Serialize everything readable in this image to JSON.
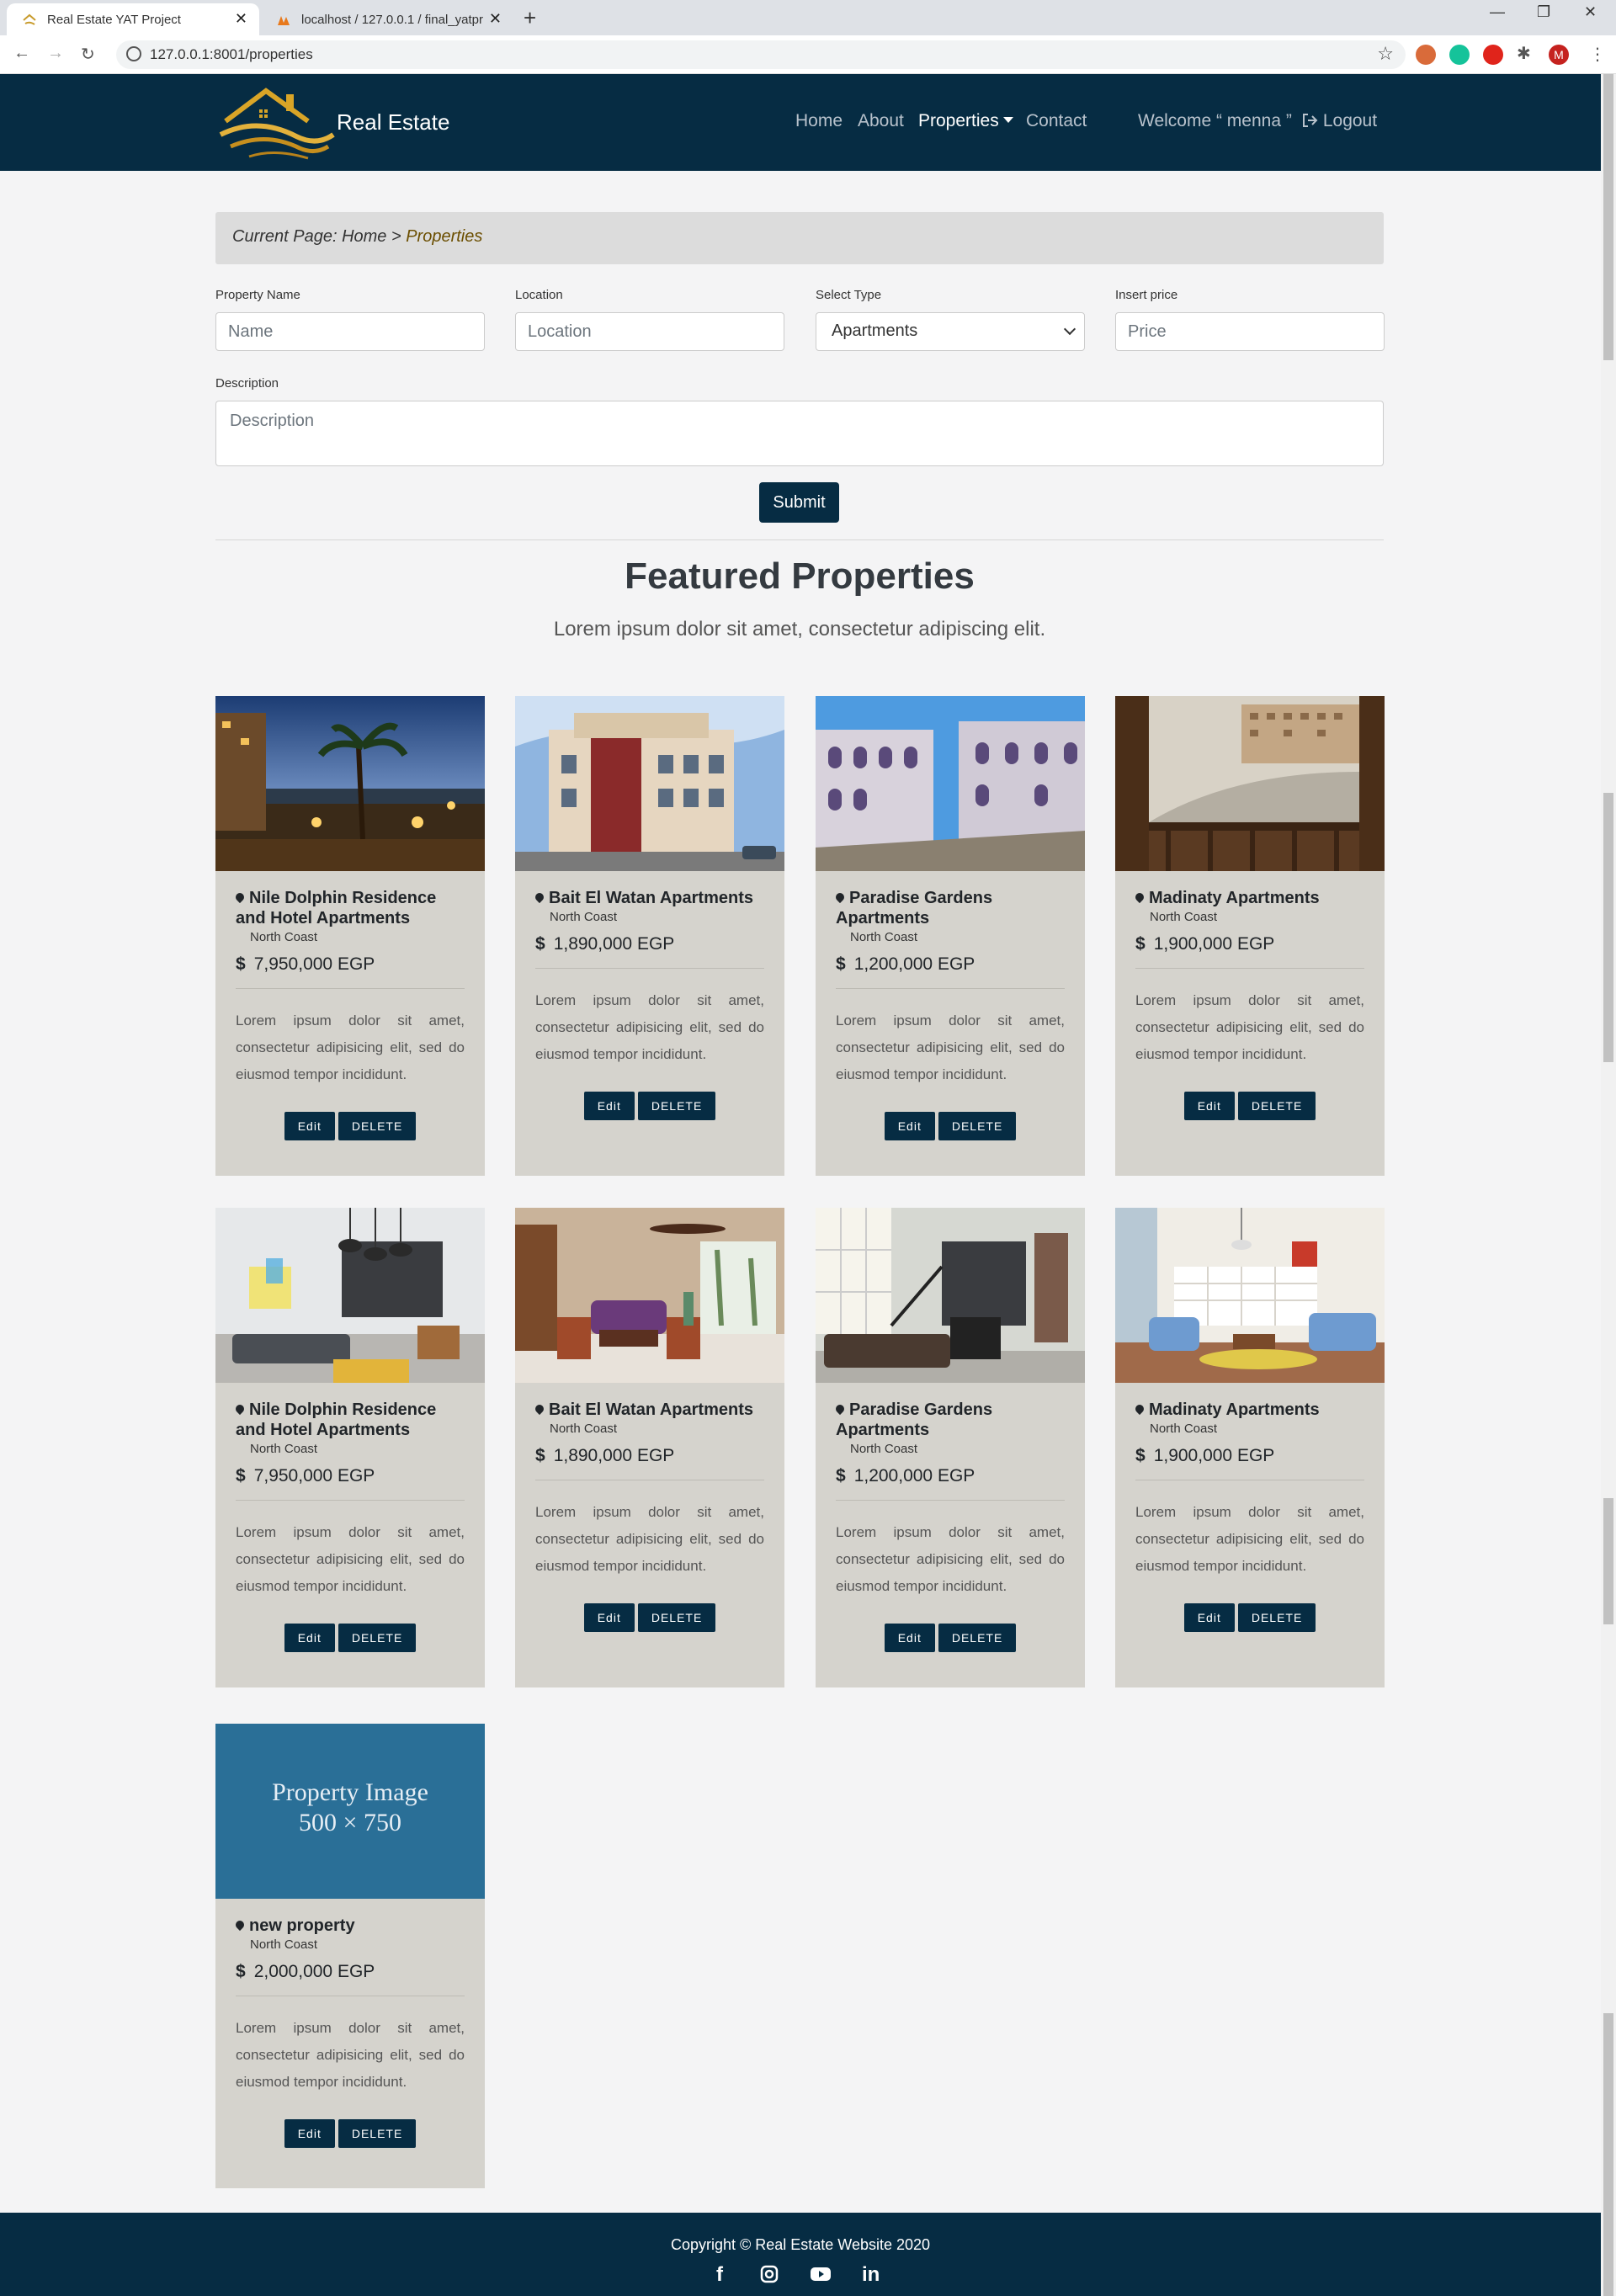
{
  "browser": {
    "tabs": [
      {
        "title": "Real Estate YAT Project",
        "active": true
      },
      {
        "title": "localhost / 127.0.0.1 / final_yatpr",
        "active": false
      }
    ],
    "url": "127.0.0.1:8001/properties",
    "profile_initial": "M"
  },
  "header": {
    "brand": "Real Estate",
    "nav": {
      "home": "Home",
      "about": "About",
      "properties": "Properties",
      "contact": "Contact"
    },
    "welcome": "Welcome “ menna ”",
    "logout": "Logout"
  },
  "breadcrumb": {
    "prefix": "Current Page: Home > ",
    "current": "Properties"
  },
  "form": {
    "name_label": "Property Name",
    "name_placeholder": "Name",
    "location_label": "Location",
    "location_placeholder": "Location",
    "type_label": "Select Type",
    "type_value": "Apartments",
    "price_label": "Insert price",
    "price_placeholder": "Price",
    "description_label": "Description",
    "description_placeholder": "Description",
    "submit": "Submit"
  },
  "section": {
    "title": "Featured Properties",
    "subtitle": "Lorem ipsum dolor sit amet, consectetur adipiscing elit."
  },
  "properties": [
    {
      "title": "Nile Dolphin Residence and Hotel Apartments",
      "location": "North Coast",
      "price": "7,950,000 EGP",
      "description": "Lorem ipsum dolor sit amet, consectetur adipisicing elit, sed do eiusmod tempor incididunt.",
      "image": "night-pool-palms"
    },
    {
      "title": "Bait El Watan Apartments",
      "location": "North Coast",
      "price": "1,890,000 EGP",
      "description": "Lorem ipsum dolor sit amet, consectetur adipisicing elit, sed do eiusmod tempor incididunt.",
      "image": "classic-building"
    },
    {
      "title": "Paradise Gardens Apartments",
      "location": "North Coast",
      "price": "1,200,000 EGP",
      "description": "Lorem ipsum dolor sit amet, consectetur adipisicing elit, sed do eiusmod tempor incididunt.",
      "image": "compound-buildings"
    },
    {
      "title": "Madinaty Apartments",
      "location": "North Coast",
      "price": "1,900,000 EGP",
      "description": "Lorem ipsum dolor sit amet, consectetur adipisicing elit, sed do eiusmod tempor incididunt.",
      "image": "balcony-street-view"
    },
    {
      "title": "Nile Dolphin Residence and Hotel Apartments",
      "location": "North Coast",
      "price": "7,950,000 EGP",
      "description": "Lorem ipsum dolor sit amet, consectetur adipisicing elit, sed do eiusmod tempor incididunt.",
      "image": "modern-living-room"
    },
    {
      "title": "Bait El Watan Apartments",
      "location": "North Coast",
      "price": "1,890,000 EGP",
      "description": "Lorem ipsum dolor sit amet, consectetur adipisicing elit, sed do eiusmod tempor incididunt.",
      "image": "hotel-living-room"
    },
    {
      "title": "Paradise Gardens Apartments",
      "location": "North Coast",
      "price": "1,200,000 EGP",
      "description": "Lorem ipsum dolor sit amet, consectetur adipisicing elit, sed do eiusmod tempor incididunt.",
      "image": "loft-interior"
    },
    {
      "title": "Madinaty Apartments",
      "location": "North Coast",
      "price": "1,900,000 EGP",
      "description": "Lorem ipsum dolor sit amet, consectetur adipisicing elit, sed do eiusmod tempor incididunt.",
      "image": "bright-lounge"
    },
    {
      "title": "new property",
      "location": "North Coast",
      "price": "2,000,000 EGP",
      "description": "Lorem ipsum dolor sit amet, consectetur adipisicing elit, sed do eiusmod tempor incididunt.",
      "image": "placeholder"
    }
  ],
  "placeholder_image": {
    "line1": "Property Image",
    "line2": "500 × 750"
  },
  "card_buttons": {
    "edit": "Edit",
    "delete": "DELETE"
  },
  "footer": {
    "copyright": "Copyright © Real Estate Website 2020"
  },
  "colors": {
    "navy": "#062c43",
    "card": "#d5d3cd",
    "placeholder": "#2a6f97"
  }
}
